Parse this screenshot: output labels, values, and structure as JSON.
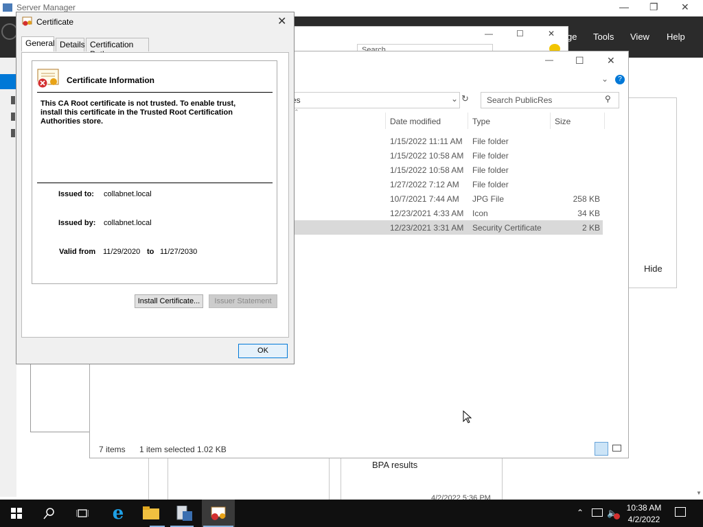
{
  "server_manager": {
    "title": "Server Manager",
    "menu": {
      "manage_partial": "ge",
      "tools": "Tools",
      "view": "View",
      "help": "Help"
    },
    "hide_label": "Hide",
    "bpa_label": "BPA results",
    "bpa_date_partial": "4/2/2022 5:36 PM"
  },
  "explorer": {
    "search_placeholder": "Search PublicRes",
    "back_search": "Search",
    "address_partial": "es",
    "columns": {
      "date": "Date modified",
      "type": "Type",
      "size": "Size"
    },
    "rows": [
      {
        "date": "1/15/2022 11:11 AM",
        "type": "File folder",
        "size": ""
      },
      {
        "date": "1/15/2022 10:58 AM",
        "type": "File folder",
        "size": ""
      },
      {
        "date": "1/15/2022 10:58 AM",
        "type": "File folder",
        "size": ""
      },
      {
        "date": "1/27/2022 7:12 AM",
        "type": "File folder",
        "size": ""
      },
      {
        "date": "10/7/2021 7:44 AM",
        "type": "JPG File",
        "size": "258 KB"
      },
      {
        "date": "12/23/2021 4:33 AM",
        "type": "Icon",
        "size": "34 KB"
      },
      {
        "date": "12/23/2021 3:31 AM",
        "type": "Security Certificate",
        "size": "2 KB"
      }
    ],
    "status": {
      "items": "7 items",
      "selected": "1 item selected  1.02 KB"
    }
  },
  "certificate": {
    "title": "Certificate",
    "tabs": [
      "General",
      "Details",
      "Certification Path"
    ],
    "info_heading": "Certificate Information",
    "warning_line1": "This CA Root certificate is not trusted. To enable trust,",
    "warning_line2": "install this certificate in the Trusted Root Certification",
    "warning_line3": "Authorities store.",
    "issued_to_label": "Issued to:",
    "issued_to": "collabnet.local",
    "issued_by_label": "Issued by:",
    "issued_by": "collabnet.local",
    "valid_from_label": "Valid from",
    "valid_from": "11/29/2020",
    "to_label": "to",
    "valid_to": "11/27/2030",
    "install_button": "Install Certificate...",
    "issuer_button": "Issuer Statement",
    "ok_button": "OK"
  },
  "taskbar": {
    "time": "10:38 AM",
    "date": "4/2/2022"
  },
  "colors": {
    "accent": "#0078d7",
    "dark_header": "#2b2b2b",
    "taskbar": "#101010"
  }
}
